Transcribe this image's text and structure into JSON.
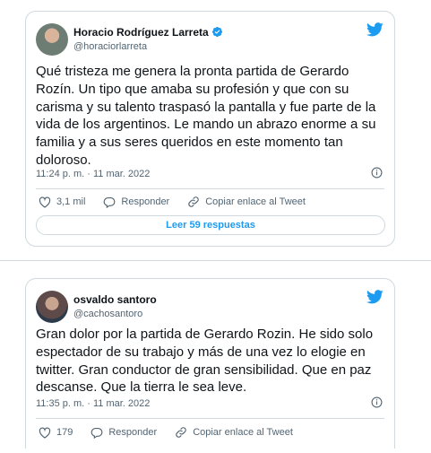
{
  "tweets": [
    {
      "name": "Horacio Rodríguez Larreta",
      "handle": "@horaciorlarreta",
      "verified": true,
      "text": "Qué tristeza me genera la pronta partida de Gerardo Rozín. Un tipo que amaba su profesión y que con su carisma y su talento traspasó la pantalla y fue parte de la vida de los argentinos. Le mando un abrazo enorme a su familia y a sus seres queridos en este momento tan doloroso.",
      "timestamp": "11:24 p. m. · 11 mar. 2022",
      "likes": "3,1 mil",
      "reply_label": "Responder",
      "copy_label": "Copiar enlace al Tweet",
      "read_replies": "Leer 59 respuestas"
    },
    {
      "name": "osvaldo santoro",
      "handle": "@cachosantoro",
      "verified": false,
      "text": "Gran dolor por la partida de Gerardo Rozin. He sido solo espectador de su trabajo y más de una vez lo elogie en twitter. Gran conductor de gran sensibilidad. Que en paz descanse. Que la tierra le sea leve.",
      "timestamp": "11:35 p. m. · 11 mar. 2022",
      "likes": "179",
      "reply_label": "Responder",
      "copy_label": "Copiar enlace al Tweet"
    }
  ],
  "colors": {
    "twitter_blue": "#1d9bf0",
    "secondary_text": "#536471",
    "border": "#cfd9de"
  },
  "icons": [
    "twitter-bird-icon",
    "verified-badge-icon",
    "info-icon",
    "heart-icon",
    "reply-icon",
    "link-icon"
  ]
}
